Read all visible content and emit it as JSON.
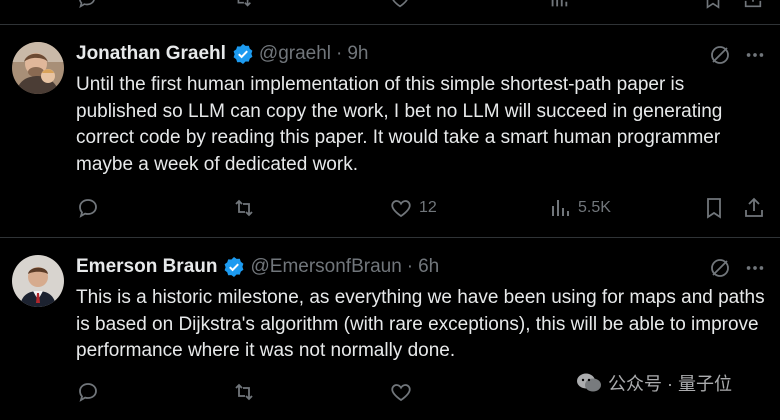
{
  "top_actions": {},
  "tweets": [
    {
      "name": "Jonathan Graehl",
      "handle": "@graehl",
      "time": "9h",
      "text": "Until the first human implementation of this simple shortest-path paper is published so LLM can copy the work, I bet no LLM will succeed in generating correct code by reading this paper. It would take a smart human programmer maybe a week of dedicated work.",
      "likes": "12",
      "views": "5.5K"
    },
    {
      "name": "Emerson Braun",
      "handle": "@EmersonfBraun",
      "time": "6h",
      "text": "This is a historic milestone, as everything we have been using for maps and paths is based on Dijkstra's algorithm (with rare exceptions), this will be able to improve performance where it was not normally done."
    }
  ],
  "watermark": {
    "text": "公众号 · 量子位"
  },
  "colors": {
    "background": "#000000",
    "text": "#e7e9ea",
    "muted": "#71767b",
    "verified": "#1d9bf0",
    "divider": "#2f3336"
  }
}
